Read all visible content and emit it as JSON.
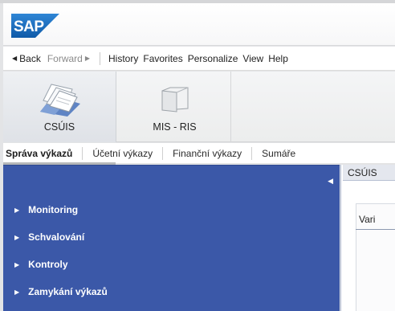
{
  "header": {
    "logo_text": "SAP",
    "brand_color": "#1a6ec0"
  },
  "nav": {
    "back": "Back",
    "forward": "Forward",
    "menus": [
      "History",
      "Favorites",
      "Personalize",
      "View",
      "Help"
    ]
  },
  "workcenters": [
    {
      "label": "CSÚIS",
      "icon": "papers-folder-icon",
      "active": true
    },
    {
      "label": "MIS - RIS",
      "icon": "folder-icon",
      "active": false
    }
  ],
  "tabs": [
    "Správa výkazů",
    "Účetní výkazy",
    "Finanční výkazy",
    "Sumáře"
  ],
  "leftnav": {
    "items": [
      "Monitoring",
      "Schvalování",
      "Kontroly",
      "Zamykání výkazů"
    ],
    "panel_color": "#3b58a8"
  },
  "content": {
    "tab_label": "CSÚIS",
    "field_label": "Vari"
  }
}
